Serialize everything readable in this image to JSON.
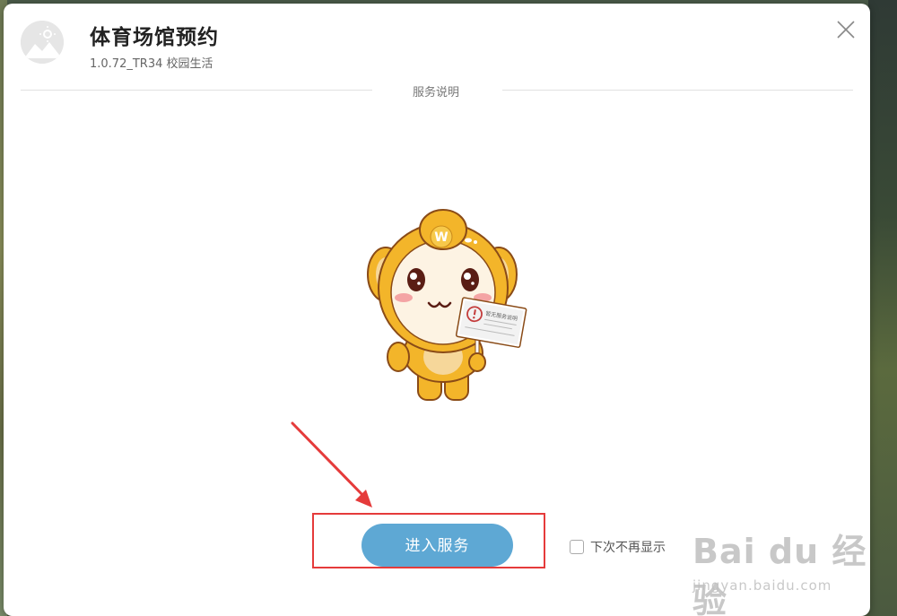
{
  "app": {
    "title": "体育场馆预约",
    "version_line": "1.0.72_TR34 校园生活"
  },
  "section": {
    "label": "服务说明"
  },
  "mascot": {
    "badge_letter": "W",
    "sign_text": "暂无服务说明"
  },
  "actions": {
    "enter_label": "进入服务",
    "dont_show_label": "下次不再显示"
  },
  "watermark": {
    "brand": "Bai du 经验",
    "sub": "jingyan.baidu.com"
  },
  "icons": {
    "app": "image-icon",
    "close": "close-icon",
    "arrow": "red-arrow-annotation"
  },
  "colors": {
    "primary_button": "#5ea8d4",
    "annotation_red": "#e53b3b",
    "mascot_yellow": "#f3b52a"
  }
}
